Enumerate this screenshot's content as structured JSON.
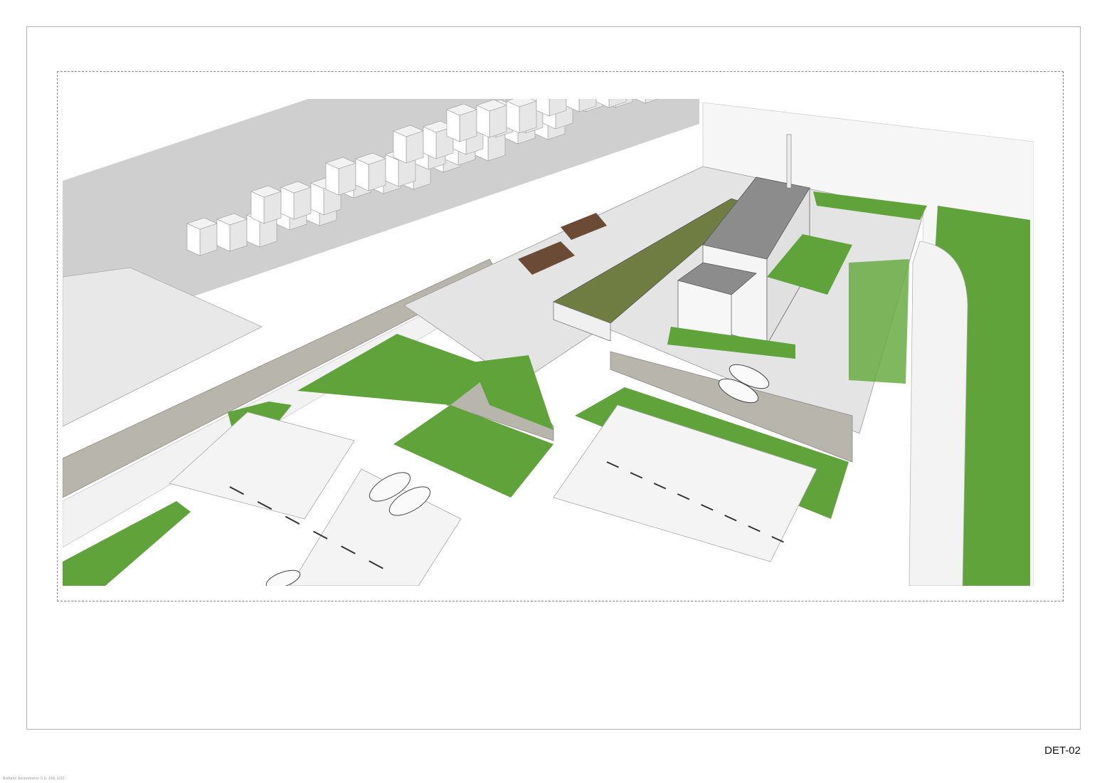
{
  "sheet": {
    "code": "DET-02",
    "footer_note": "Bildtafel Axonometrie S.0, 150, 1/30"
  },
  "render": {
    "description_icon": "axonometric-site-render",
    "colors": {
      "lawn": "#5fa33a",
      "lawn_dark": "#3f7f23",
      "roof_garden": "#6f7d43",
      "gravel_roof": "#8c8c8c",
      "paving": "#e6e6e6",
      "ground": "#d2d2d2",
      "stone_wall": "#b8b5ad",
      "soil": "#6b4a36"
    }
  }
}
